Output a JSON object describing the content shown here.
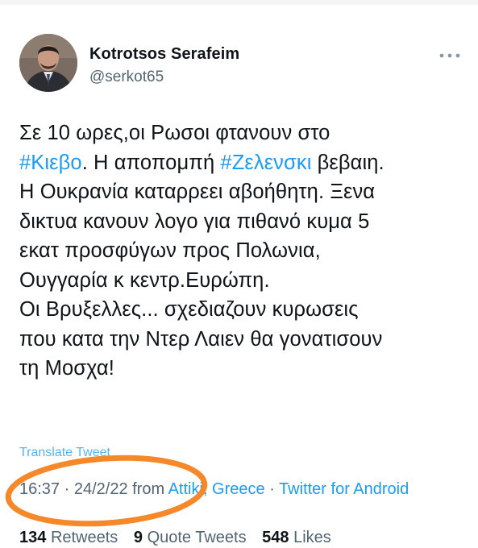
{
  "author": {
    "display_name": "Kotrotsos Serafeim",
    "handle": "@serkot65",
    "more_icon": "more-horizontal-icon"
  },
  "tweet": {
    "line1": "Σε 10 ωρες,οι Ρωσοι φτανουν στο",
    "hashtag1": "#Κιεβο",
    "line2_mid": ". Η αποπομπή ",
    "hashtag2": "#Ζελενσκι",
    "line2_end": " βεβαιη.",
    "line3": "Η Ουκρανία καταρρεει αβοήθητη. Ξενα",
    "line4": "δικτυα κανουν λογο για πιθανό κυμα 5",
    "line5": "εκατ προσφύγων προς Πολωνια,",
    "line6": "Ουγγαρία κ κεντρ.Ευρώπη.",
    "line7": "Οι Βρυξελλες... σχεδιαζουν κυρωσεις",
    "line8": "που κατα την Ντερ Λαιεν θα γονατισουν",
    "line9": "τη Μοσχα!"
  },
  "translate_label": "Translate Tweet",
  "meta": {
    "time": "16:37",
    "separator": " · ",
    "date": "24/2/22",
    "from_label": " from ",
    "location": "Attiki, Greece",
    "source": "Twitter for Android"
  },
  "stats": {
    "retweets_count": "134",
    "retweets_label": "Retweets",
    "quotes_count": "9",
    "quotes_label": "Quote Tweets",
    "likes_count": "548",
    "likes_label": "Likes"
  },
  "colors": {
    "link": "#1d9bf0",
    "secondary_text": "#536471",
    "primary_text": "#0f1419",
    "highlight_ellipse": "#f5892a"
  }
}
